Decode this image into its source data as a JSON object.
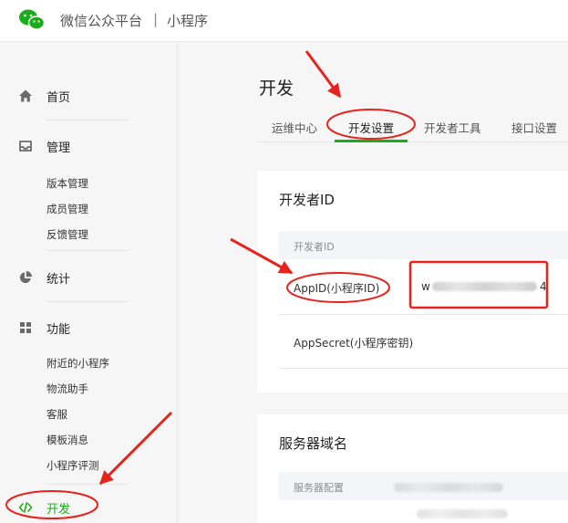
{
  "header": {
    "brand": "微信公众平台",
    "separator": "|",
    "product": "小程序"
  },
  "sidebar": {
    "home": "首页",
    "manage": "管理",
    "manage_items": [
      "版本管理",
      "成员管理",
      "反馈管理"
    ],
    "stats": "统计",
    "features": "功能",
    "feature_items": [
      "附近的小程序",
      "物流助手",
      "客服",
      "模板消息",
      "小程序评测"
    ],
    "develop": "开发"
  },
  "main": {
    "title": "开发",
    "tabs": [
      "运维中心",
      "开发设置",
      "开发者工具",
      "接口设置"
    ],
    "active_tab": "开发设置",
    "developer_card": {
      "title": "开发者ID",
      "table_header": "开发者ID",
      "appid_label": "AppID(小程序ID)",
      "appid_prefix": "w",
      "appid_suffix": "4",
      "appsecret_label": "AppSecret(小程序密钥)"
    },
    "server_card": {
      "title": "服务器域名",
      "table_header": "服务器配置"
    }
  },
  "colors": {
    "accent": "#1aad19",
    "annotation_red": "#e8231e"
  },
  "icons": {
    "home": "home-icon",
    "manage": "inbox-icon",
    "stats": "pie-chart-icon",
    "features": "grid-icon",
    "develop": "code-icon"
  }
}
